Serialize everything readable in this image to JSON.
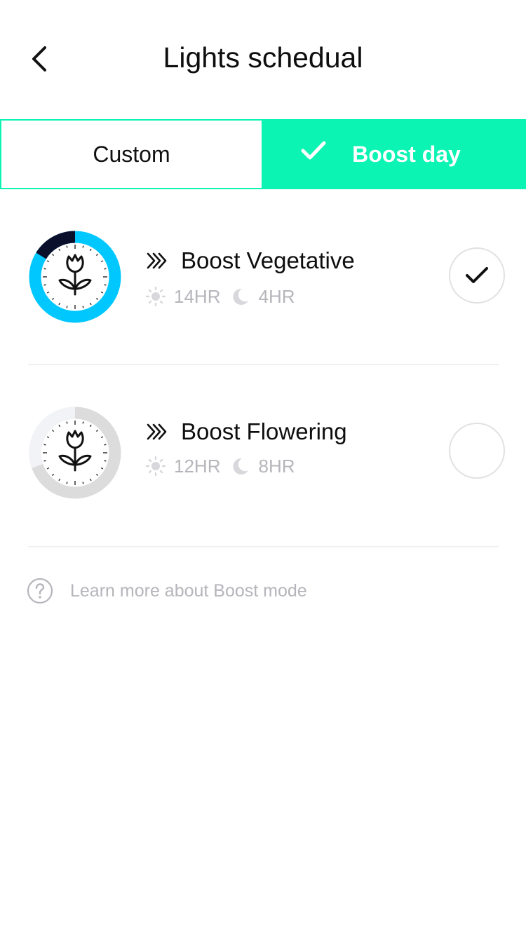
{
  "header": {
    "title": "Lights schedual"
  },
  "tabs": [
    {
      "label": "Custom",
      "selected": false
    },
    {
      "label": "Boost day",
      "selected": true
    }
  ],
  "colors": {
    "accent": "#0bf4b3",
    "ring_light": "#00c8ff",
    "ring_dark": "#0a0f2c",
    "ring_grey": "#dcdcdc",
    "muted": "#b5b5bb"
  },
  "schedules": [
    {
      "name": "Boost Vegetative",
      "light": "14HR",
      "dark": "4HR",
      "light_fraction": 0.778,
      "selected": true,
      "icons": [
        "boost-chevrons-icon",
        "sun-icon",
        "moon-icon",
        "tulip-icon"
      ]
    },
    {
      "name": "Boost Flowering",
      "light": "12HR",
      "dark": "8HR",
      "light_fraction": 0.6,
      "selected": false,
      "icons": [
        "boost-chevrons-icon",
        "sun-icon",
        "moon-icon",
        "tulip-icon"
      ]
    }
  ],
  "footer": {
    "learn_more": "Learn more about Boost mode",
    "icon": "help-circle-icon"
  }
}
